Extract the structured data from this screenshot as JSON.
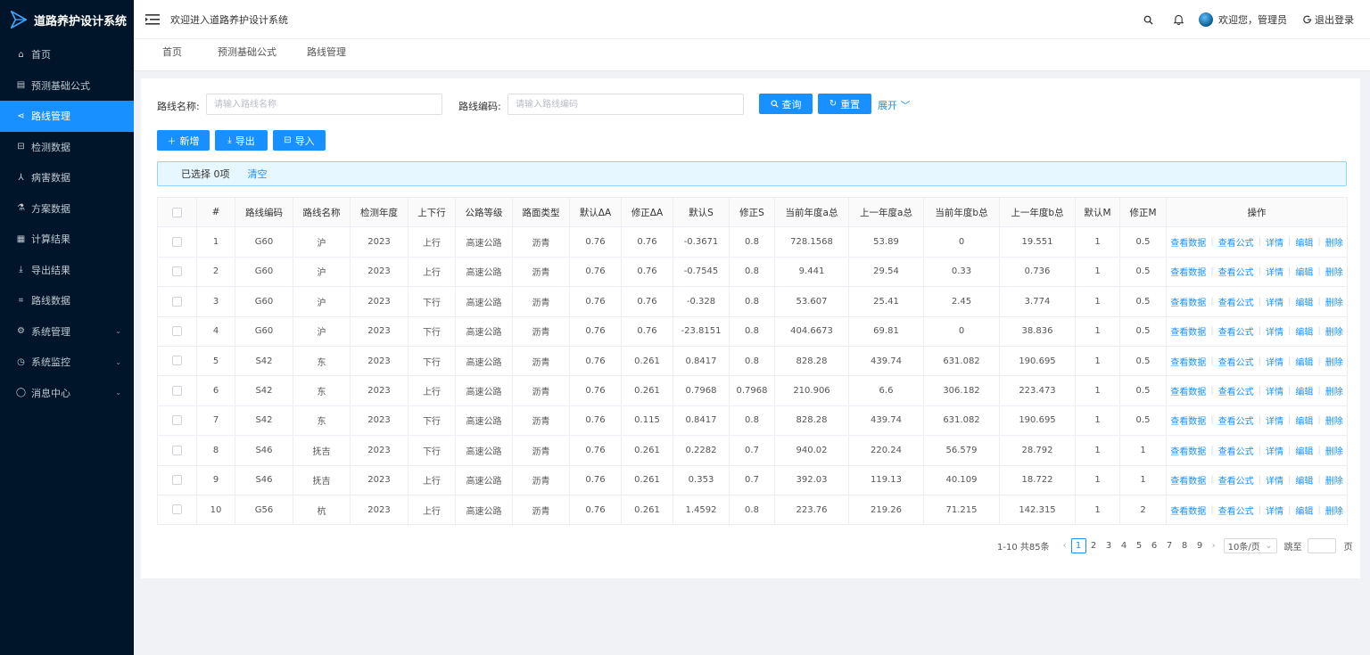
{
  "app": {
    "title": "道路养护设计系统"
  },
  "sidebar": {
    "items": [
      {
        "label": "首页",
        "icon": "home-icon",
        "glyph": "⌂",
        "active": false,
        "caret": false
      },
      {
        "label": "预测基础公式",
        "icon": "table-icon",
        "glyph": "▤",
        "active": false,
        "caret": false
      },
      {
        "label": "路线管理",
        "icon": "share-icon",
        "glyph": "⋖",
        "active": true,
        "caret": false
      },
      {
        "label": "检测数据",
        "icon": "car-icon",
        "glyph": "⊟",
        "active": false,
        "caret": false
      },
      {
        "label": "病害数据",
        "icon": "graph-icon",
        "glyph": "⅄",
        "active": false,
        "caret": false
      },
      {
        "label": "方案数据",
        "icon": "flask-icon",
        "glyph": "⚗",
        "active": false,
        "caret": false
      },
      {
        "label": "计算结果",
        "icon": "calculator-icon",
        "glyph": "▦",
        "active": false,
        "caret": false
      },
      {
        "label": "导出结果",
        "icon": "download-icon",
        "glyph": "⤓",
        "active": false,
        "caret": false
      },
      {
        "label": "路线数据",
        "icon": "route-icon",
        "glyph": "⌗",
        "active": false,
        "caret": false
      },
      {
        "label": "系统管理",
        "icon": "gear-icon",
        "glyph": "⚙",
        "active": false,
        "caret": true
      },
      {
        "label": "系统监控",
        "icon": "monitor-icon",
        "glyph": "◷",
        "active": false,
        "caret": true
      },
      {
        "label": "消息中心",
        "icon": "message-icon",
        "glyph": "◯",
        "active": false,
        "caret": true
      }
    ]
  },
  "header": {
    "welcome": "欢迎进入道路养护设计系统",
    "user_greeting": "欢迎您，管理员",
    "logout": "退出登录"
  },
  "tabs": [
    {
      "label": "首页",
      "active": false
    },
    {
      "label": "预测基础公式",
      "active": false
    },
    {
      "label": "路线管理",
      "active": true
    }
  ],
  "search": {
    "name_label": "路线名称:",
    "name_placeholder": "请输入路线名称",
    "code_label": "路线编码:",
    "code_placeholder": "请输入路线编码",
    "query_button": "查询",
    "reset_button": "重置",
    "expand": "展开"
  },
  "toolbar": {
    "add": "新增",
    "export": "导出",
    "import": "导入"
  },
  "selection": {
    "text": "已选择 0项",
    "clear": "清空"
  },
  "table": {
    "columns": [
      "#",
      "路线编码",
      "路线名称",
      "检测年度",
      "上下行",
      "公路等级",
      "路面类型",
      "默认ΔA",
      "修正ΔA",
      "默认S",
      "修正S",
      "当前年度a总",
      "上一年度a总",
      "当前年度b总",
      "上一年度b总",
      "默认M",
      "修正M",
      "操作"
    ],
    "actions": [
      "查看数据",
      "查看公式",
      "详情",
      "编辑",
      "删除"
    ],
    "rows": [
      [
        "1",
        "G60",
        "沪",
        "2023",
        "上行",
        "高速公路",
        "沥青",
        "0.76",
        "0.76",
        "-0.3671",
        "0.8",
        "728.1568",
        "53.89",
        "0",
        "19.551",
        "1",
        "0.5"
      ],
      [
        "2",
        "G60",
        "沪",
        "2023",
        "上行",
        "高速公路",
        "沥青",
        "0.76",
        "0.76",
        "-0.7545",
        "0.8",
        "9.441",
        "29.54",
        "0.33",
        "0.736",
        "1",
        "0.5"
      ],
      [
        "3",
        "G60",
        "沪",
        "2023",
        "下行",
        "高速公路",
        "沥青",
        "0.76",
        "0.76",
        "-0.328",
        "0.8",
        "53.607",
        "25.41",
        "2.45",
        "3.774",
        "1",
        "0.5"
      ],
      [
        "4",
        "G60",
        "沪",
        "2023",
        "下行",
        "高速公路",
        "沥青",
        "0.76",
        "0.76",
        "-23.8151",
        "0.8",
        "404.6673",
        "69.81",
        "0",
        "38.836",
        "1",
        "0.5"
      ],
      [
        "5",
        "S42",
        "东",
        "2023",
        "下行",
        "高速公路",
        "沥青",
        "0.76",
        "0.261",
        "0.8417",
        "0.8",
        "828.28",
        "439.74",
        "631.082",
        "190.695",
        "1",
        "0.5"
      ],
      [
        "6",
        "S42",
        "东",
        "2023",
        "上行",
        "高速公路",
        "沥青",
        "0.76",
        "0.261",
        "0.7968",
        "0.7968",
        "210.906",
        "6.6",
        "306.182",
        "223.473",
        "1",
        "0.5"
      ],
      [
        "7",
        "S42",
        "东",
        "2023",
        "下行",
        "高速公路",
        "沥青",
        "0.76",
        "0.115",
        "0.8417",
        "0.8",
        "828.28",
        "439.74",
        "631.082",
        "190.695",
        "1",
        "0.5"
      ],
      [
        "8",
        "S46",
        "抚吉",
        "2023",
        "下行",
        "高速公路",
        "沥青",
        "0.76",
        "0.261",
        "0.2282",
        "0.7",
        "940.02",
        "220.24",
        "56.579",
        "28.792",
        "1",
        "1"
      ],
      [
        "9",
        "S46",
        "抚吉",
        "2023",
        "上行",
        "高速公路",
        "沥青",
        "0.76",
        "0.261",
        "0.353",
        "0.7",
        "392.03",
        "119.13",
        "40.109",
        "18.722",
        "1",
        "1"
      ],
      [
        "10",
        "G56",
        "杭",
        "2023",
        "上行",
        "高速公路",
        "沥青",
        "0.76",
        "0.261",
        "1.4592",
        "0.8",
        "223.76",
        "219.26",
        "71.215",
        "142.315",
        "1",
        "2"
      ]
    ]
  },
  "pagination": {
    "total": "1-10 共85条",
    "pages": [
      "1",
      "2",
      "3",
      "4",
      "5",
      "6",
      "7",
      "8",
      "9"
    ],
    "current": "1",
    "page_size": "10条/页",
    "jump_label": "跳至",
    "page_suffix": "页"
  },
  "colors": {
    "primary": "#1890ff",
    "sidebar_bg": "#001529"
  }
}
